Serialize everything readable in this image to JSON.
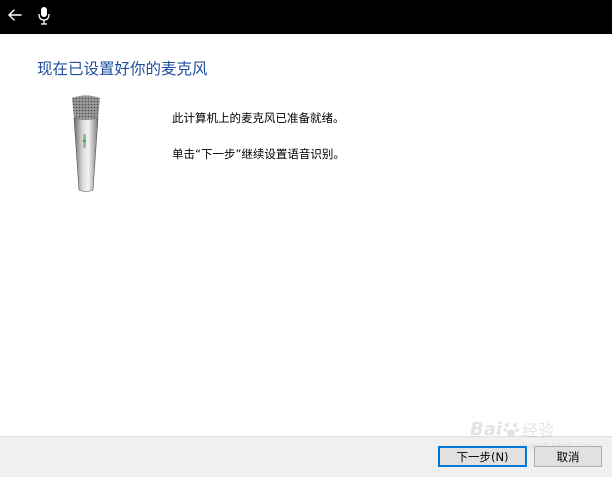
{
  "window": {
    "heading": "现在已设置好你的麦克风",
    "body": {
      "line1": "此计算机上的麦克风已准备就绪。",
      "line2": "单击“下一步”继续设置语音识别。"
    }
  },
  "icons": {
    "back": "back-arrow-icon",
    "titlebar_mic": "microphone-icon",
    "illustration": "microphone-illustration"
  },
  "footer": {
    "next_label": "下一步(N)",
    "cancel_label": "取消"
  },
  "watermark": {
    "brand": "Bai",
    "suffix": "经验",
    "url": "jingyan.baidu.com"
  },
  "colors": {
    "titlebar": "#000000",
    "heading": "#1f4e9c",
    "footer_bg": "#f0f0f0",
    "focus_border": "#0078d7"
  }
}
